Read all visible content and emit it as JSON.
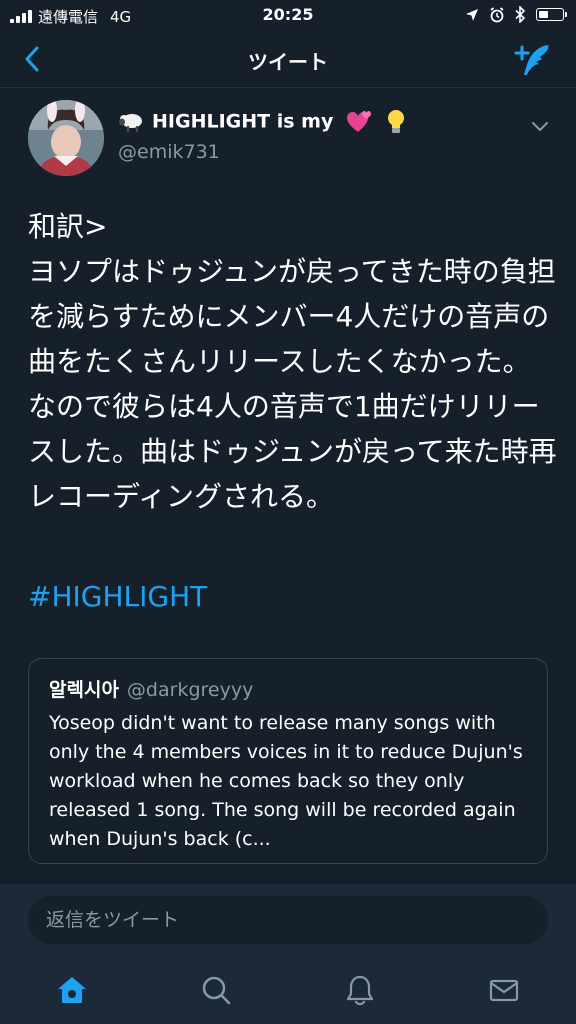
{
  "status_bar": {
    "carrier": "遠傳電信",
    "network": "4G",
    "time": "20:25",
    "battery_level": 0.45
  },
  "nav": {
    "title": "ツイート",
    "accent_color": "#1da1f2"
  },
  "tweet": {
    "display_name": "HIGHLIGHT  is my",
    "handle": "@emik731",
    "name_emojis": [
      "sheep-emoji",
      "two-hearts-emoji",
      "light-bulb-emoji"
    ],
    "text": "和訳>\nヨソプはドゥジュンが戻ってきた時の負担を減らすためにメンバー4人だけの音声の曲をたくさんリリースしたくなかった。なので彼らは4人の音声で1曲だけリリースした。曲はドゥジュンが戻って来た時再レコーディングされる。",
    "hashtag": "#HIGHLIGHT"
  },
  "quote": {
    "name": "알렉시아",
    "handle": "@darkgreyyy",
    "text": "Yoseop didn't want to release many songs with only the 4 members voices in it to reduce Dujun's workload when he comes back so they only released 1 song. The song will be recorded again when Dujun's back (c..."
  },
  "reply": {
    "placeholder": "返信をツイート"
  },
  "tabs": [
    {
      "icon": "home-icon",
      "active": true
    },
    {
      "icon": "search-icon",
      "active": false
    },
    {
      "icon": "bell-icon",
      "active": false
    },
    {
      "icon": "mail-icon",
      "active": false
    }
  ],
  "colors": {
    "background": "#15202b",
    "bar": "#1c2938",
    "secondary_text": "#8899a6",
    "accent": "#1da1f2"
  }
}
